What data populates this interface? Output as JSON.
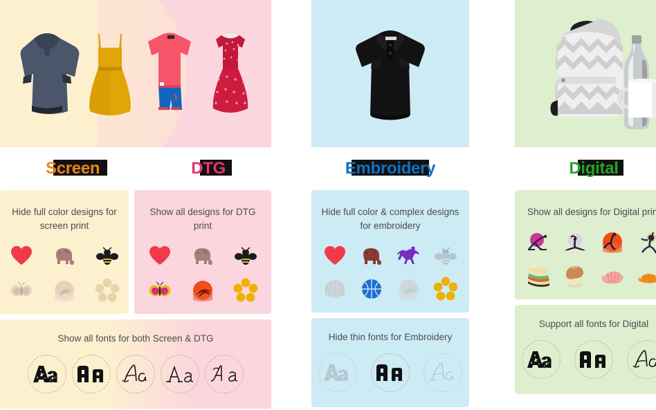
{
  "columns": [
    {
      "key": "screen_dtg",
      "labels": [
        {
          "name": "Screen",
          "color": "#EE8317"
        },
        {
          "name": "DTG",
          "color": "#E8346B"
        }
      ],
      "hero": {
        "bg_left": "#FDF0CF",
        "bg_right": "#FBD6DE",
        "items": [
          "navy-hoodie",
          "mustard-dress",
          "coral-tshirt-blue-shorts",
          "red-polka-dress"
        ]
      },
      "design_cards": [
        {
          "title": "Hide full color designs for screen print",
          "bg": "#FDF0CF",
          "columns": 3,
          "icons": [
            {
              "name": "heart-icon",
              "faded": false
            },
            {
              "name": "elephant-icon",
              "faded": false
            },
            {
              "name": "bee-icon",
              "faded": false
            },
            {
              "name": "butterfly-icon",
              "faded": true
            },
            {
              "name": "sunset-bird-icon",
              "faded": true
            },
            {
              "name": "flower-icon",
              "faded": true
            }
          ]
        },
        {
          "title": "Show all designs for DTG print",
          "bg": "#FBD6DE",
          "columns": 3,
          "icons": [
            {
              "name": "heart-icon",
              "faded": false
            },
            {
              "name": "elephant-icon",
              "faded": false
            },
            {
              "name": "bee-icon",
              "faded": false
            },
            {
              "name": "butterfly-icon",
              "faded": false
            },
            {
              "name": "sunset-bird-icon",
              "faded": false
            },
            {
              "name": "flower-icon",
              "faded": false
            }
          ]
        }
      ],
      "font_card": {
        "title": "Show all fonts for both Screen & DTG",
        "samples": [
          {
            "name": "decorative-slab-aa",
            "style": "slab-grunge",
            "dim": false,
            "text": "Aa"
          },
          {
            "name": "block-bold-aa",
            "style": "block",
            "dim": false,
            "text": "Aa"
          },
          {
            "name": "script-aa",
            "style": "script",
            "dim": false,
            "text": "Aa"
          },
          {
            "name": "serif-aa",
            "style": "serif",
            "dim": false,
            "text": "Aa"
          },
          {
            "name": "fancy-serif-aa",
            "style": "fancy-serif",
            "dim": false,
            "text": "Aa"
          }
        ]
      }
    },
    {
      "key": "embroidery",
      "labels": [
        {
          "name": "Embroidery",
          "color": "#1170C4"
        }
      ],
      "hero": {
        "bg": "#CDEBF5",
        "items": [
          "black-polo-shirt"
        ]
      },
      "design_cards": [
        {
          "title": "Hide full color & complex designs for embroidery",
          "bg": "#CDEBF5",
          "columns": 4,
          "icons": [
            {
              "name": "heart-icon",
              "faded": false
            },
            {
              "name": "elephant-icon",
              "faded": false
            },
            {
              "name": "horse-rider-icon",
              "faded": false
            },
            {
              "name": "bee-icon",
              "faded": true
            },
            {
              "name": "shell-icon",
              "faded": true
            },
            {
              "name": "basketball-icon",
              "faded": false
            },
            {
              "name": "sunset-bird-icon",
              "faded": true
            },
            {
              "name": "flower-icon",
              "faded": false
            }
          ]
        }
      ],
      "font_card": {
        "title": "Hide thin fonts for Embroidery",
        "samples": [
          {
            "name": "decorative-slab-aa",
            "style": "slab-grunge",
            "dim": true,
            "text": "Aa"
          },
          {
            "name": "block-bold-aa",
            "style": "block",
            "dim": false,
            "text": "Aa"
          },
          {
            "name": "script-aa",
            "style": "script",
            "dim": true,
            "text": "Aa"
          }
        ]
      }
    },
    {
      "key": "digital",
      "labels": [
        {
          "name": "Digital",
          "color": "#28A228"
        }
      ],
      "hero": {
        "bg": "#DDEFCE",
        "items": [
          "chevron-backpack",
          "steel-water-bottle",
          "white-mug"
        ]
      },
      "design_cards": [
        {
          "title": "Show all designs for Digital print",
          "bg": "#DDEFCE",
          "columns": 4,
          "icons": [
            {
              "name": "yoga-bow-pose-icon",
              "faded": false
            },
            {
              "name": "yoga-splits-pose-icon",
              "faded": false
            },
            {
              "name": "yoga-sun-pose-icon",
              "faded": false
            },
            {
              "name": "yoga-warrior-pose-icon",
              "faded": false
            },
            {
              "name": "sandwich-icon",
              "faded": false
            },
            {
              "name": "bread-loaf-icon",
              "faded": false
            },
            {
              "name": "croissant-pink-icon",
              "faded": false
            },
            {
              "name": "croissant-orange-icon",
              "faded": false
            }
          ]
        }
      ],
      "font_card": {
        "title": "Support all fonts for Digital",
        "samples": [
          {
            "name": "decorative-slab-aa",
            "style": "slab-grunge",
            "dim": false,
            "text": "Aa"
          },
          {
            "name": "block-bold-aa",
            "style": "block",
            "dim": false,
            "text": "Aa"
          },
          {
            "name": "script-aa",
            "style": "script",
            "dim": false,
            "text": "Aa"
          }
        ]
      }
    }
  ],
  "palette": {
    "cream": "#FDF0CF",
    "pink": "#FBD6DE",
    "light_blue": "#CDEBF5",
    "light_green": "#DDEFCE",
    "highlight_black": "#111111",
    "body_text": "#4C4C4C"
  }
}
